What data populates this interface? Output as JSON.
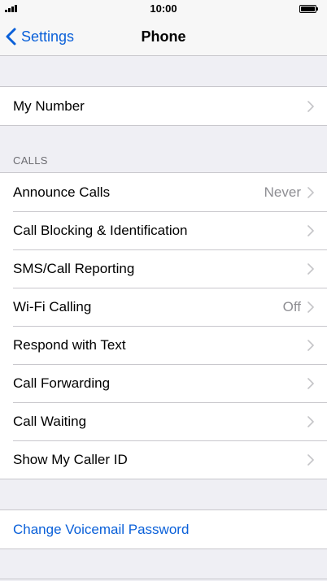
{
  "status_bar": {
    "time": "10:00"
  },
  "nav": {
    "back_label": "Settings",
    "title": "Phone"
  },
  "groups": {
    "top": {
      "items": [
        {
          "label": "My Number"
        }
      ]
    },
    "calls": {
      "header": "CALLS",
      "items": [
        {
          "label": "Announce Calls",
          "value": "Never"
        },
        {
          "label": "Call Blocking & Identification"
        },
        {
          "label": "SMS/Call Reporting"
        },
        {
          "label": "Wi-Fi Calling",
          "value": "Off"
        },
        {
          "label": "Respond with Text"
        },
        {
          "label": "Call Forwarding"
        },
        {
          "label": "Call Waiting"
        },
        {
          "label": "Show My Caller ID"
        }
      ]
    },
    "voicemail": {
      "items": [
        {
          "label": "Change Voicemail Password"
        }
      ]
    }
  },
  "icons": {
    "signal": "cellular-signal-icon",
    "battery": "battery-full-icon",
    "back": "chevron-left-icon",
    "disclosure": "chevron-right-icon"
  },
  "colors": {
    "accent": "#0a60d9",
    "background": "#efeff4",
    "secondary_text": "#8e8e93",
    "separator": "#c8c7cc"
  }
}
